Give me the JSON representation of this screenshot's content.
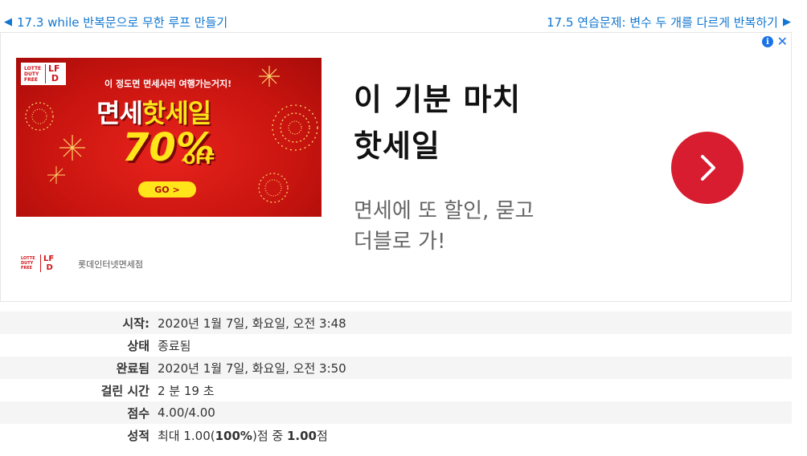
{
  "nav": {
    "prev_label": "17.3 while 반복문으로 무한 루프 만들기",
    "next_label": "17.5 연습문제: 변수 두 개를 다르게 반복하기"
  },
  "ad": {
    "banner": {
      "logo_small": "LOTTE DUTY FREE",
      "logo_brand": "L F D",
      "tagline": "이 정도면 면세사러 여행가는거지!",
      "headline_a": "면세",
      "headline_b": "핫세일",
      "percent": "70%",
      "off": "OFF",
      "go": "GO >"
    },
    "advertiser_logo_small": "LOTTE DUTY FREE",
    "advertiser_logo_brand": "L F D",
    "advertiser": "롯데인터넷면세점",
    "title_line1": "이 기분 마치",
    "title_line2": "핫세일",
    "desc_line1": "면세에 또 할인, 묻고",
    "desc_line2": "더블로 가!",
    "info_icon": "ⓘ",
    "close_icon": "✕",
    "accent_color": "#d71d2f"
  },
  "summary": {
    "rows": [
      {
        "label": "시작:",
        "value": "2020년 1월 7일, 화요일, 오전 3:48"
      },
      {
        "label": "상태",
        "value": "종료됨"
      },
      {
        "label": "완료됨",
        "value": "2020년 1월 7일, 화요일, 오전 3:50"
      },
      {
        "label": "걸린 시간",
        "value": "2 분 19 초"
      },
      {
        "label": "점수",
        "value": "4.00/4.00"
      },
      {
        "label": "성적",
        "grade_prefix": "최대 1.00(",
        "grade_pct": "100%",
        "grade_mid": ")점 중 ",
        "grade_score": "1.00",
        "grade_suffix": "점"
      }
    ]
  },
  "colors": {
    "link": "#1177d1",
    "row_shade": "#f5f5f5"
  }
}
